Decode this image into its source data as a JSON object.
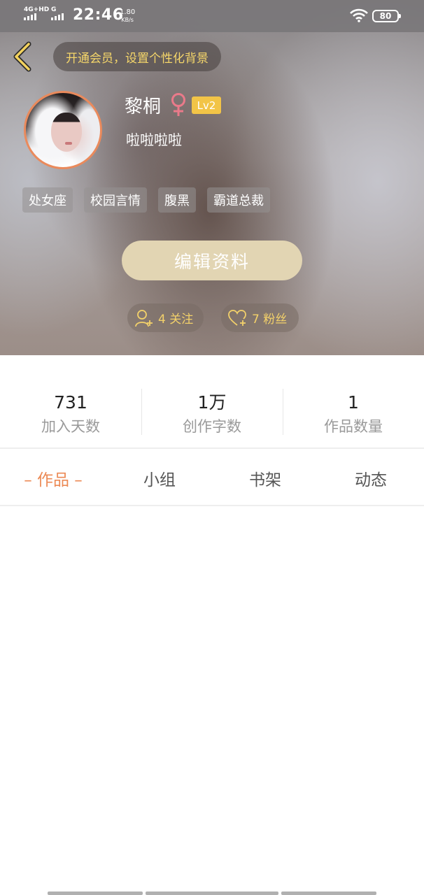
{
  "status_bar": {
    "network": "4G+HD",
    "network2": "G",
    "time": "22:46",
    "speed_value": "1.80",
    "speed_unit": "KB/s",
    "battery": "80"
  },
  "header": {
    "vip_banner": "开通会员，设置个性化背景"
  },
  "profile": {
    "username": "黎桐",
    "level": "Lv2",
    "bio": "啦啦啦啦",
    "tags": [
      "处女座",
      "校园言情",
      "腹黑",
      "霸道总裁"
    ],
    "edit_button": "编辑资料",
    "following": "4 关注",
    "fans": "7 粉丝"
  },
  "stats": [
    {
      "value": "731",
      "label": "加入天数"
    },
    {
      "value": "1万",
      "label": "创作字数"
    },
    {
      "value": "1",
      "label": "作品数量"
    }
  ],
  "tabs": [
    {
      "label": "– 作品 –",
      "active": true
    },
    {
      "label": "小组",
      "active": false
    },
    {
      "label": "书架",
      "active": false
    },
    {
      "label": "动态",
      "active": false
    }
  ],
  "colors": {
    "accent": "#ec8a55",
    "level_badge": "#f2c447",
    "banner_text": "#f5d66a",
    "edit_button": "#e2d5b3"
  },
  "icons": [
    "back-arrow-icon",
    "female-icon",
    "follow-person-icon",
    "fans-heart-icon",
    "wifi-icon",
    "battery-icon"
  ]
}
